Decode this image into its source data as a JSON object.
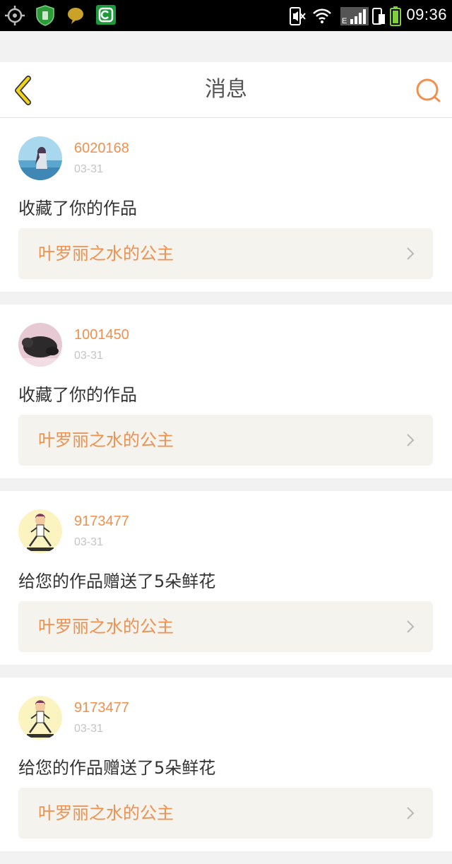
{
  "status_bar": {
    "time": "09:36",
    "network_label": "E",
    "icons": [
      "gps-icon",
      "shield-security-icon",
      "chat-bubble-icon",
      "app-c-icon",
      "mute-icon",
      "wifi-icon",
      "signal-icon",
      "phone-battery-icon",
      "battery-icon"
    ]
  },
  "header": {
    "title": "消息",
    "back_icon": "chevron-left-icon",
    "search_icon": "search-icon"
  },
  "messages": [
    {
      "username": "6020168",
      "date": "03-31",
      "action": "收藏了你的作品",
      "work_title": "叶罗丽之水的公主",
      "avatar": "avatar-girl-sea"
    },
    {
      "username": "1001450",
      "date": "03-31",
      "action": "收藏了你的作品",
      "work_title": "叶罗丽之水的公主",
      "avatar": "avatar-dark-animal"
    },
    {
      "username": "9173477",
      "date": "03-31",
      "action": "给您的作品赠送了5朵鲜花",
      "work_title": "叶罗丽之水的公主",
      "avatar": "avatar-cartoon-girl"
    },
    {
      "username": "9173477",
      "date": "03-31",
      "action": "给您的作品赠送了5朵鲜花",
      "work_title": "叶罗丽之水的公主",
      "avatar": "avatar-cartoon-girl"
    }
  ],
  "colors": {
    "accent": "#f0904e",
    "back_icon": "#f2d21a",
    "card_link_bg": "#f4f3ee",
    "page_bg": "#f2f2f2"
  }
}
